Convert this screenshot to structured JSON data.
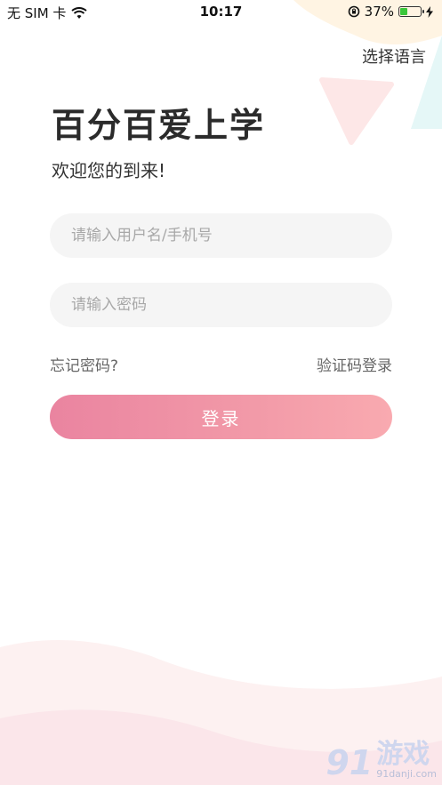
{
  "status_bar": {
    "carrier": "无 SIM 卡",
    "time": "10:17",
    "battery_percent": "37%",
    "battery_level": 0.37,
    "wifi_icon": "wifi-icon",
    "orientation_lock_icon": "orientation-lock-icon",
    "charging_icon": "charging-bolt-icon"
  },
  "header": {
    "language_label": "选择语言"
  },
  "hero": {
    "title": "百分百爱上学",
    "welcome": "欢迎您的到来!"
  },
  "form": {
    "username_placeholder": "请输入用户名/手机号",
    "password_placeholder": "请输入密码",
    "forgot_label": "忘记密码?",
    "sms_login_label": "验证码登录",
    "login_label": "登录"
  },
  "watermark": {
    "logo": "91",
    "text": "游戏",
    "site": "91danji.com"
  },
  "colors": {
    "accent_start": "#ea84a0",
    "accent_end": "#f9aab0",
    "field_bg": "#f5f5f5"
  }
}
